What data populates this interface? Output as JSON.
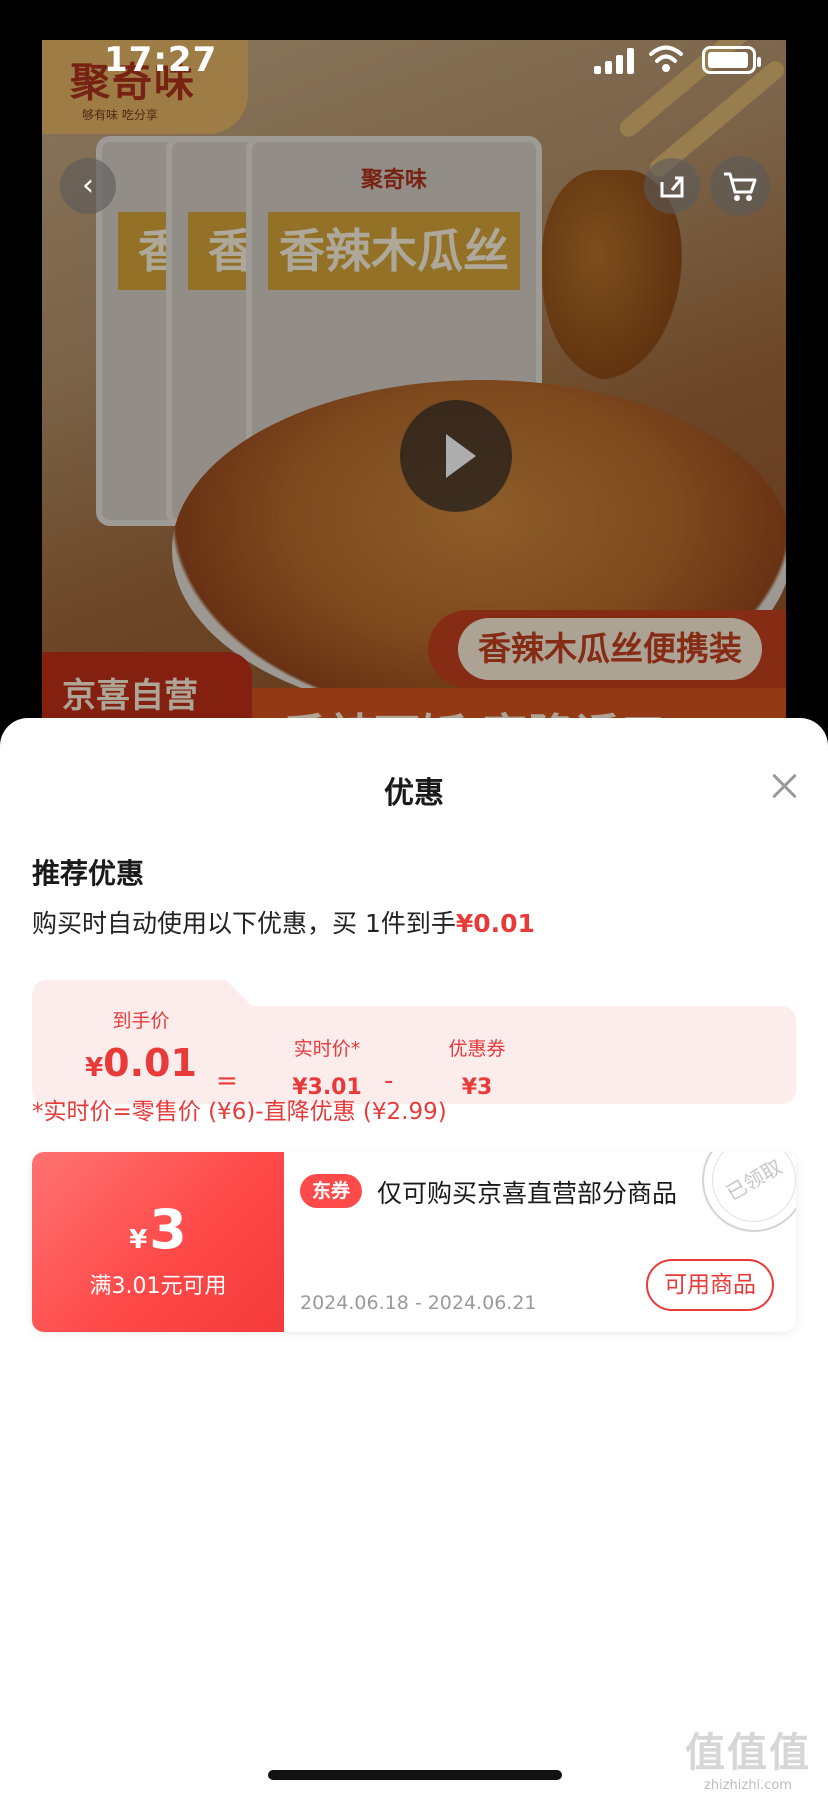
{
  "status_bar": {
    "time": "17:27"
  },
  "product_image": {
    "brand": "聚奇味",
    "brand_slogan": "够有味 吃分享",
    "pack_brand": "聚奇味",
    "pack_label": "香辣木瓜丝",
    "pack_label_short": "香",
    "subtitle": "香辣木瓜丝便携装",
    "bottom_tag": "京喜自营",
    "bottom_headline": "香辣下饭 客隆诱口"
  },
  "sheet": {
    "title": "优惠",
    "section_title": "推荐优惠",
    "desc_prefix": "购买时自动使用以下优惠，买 1件到手",
    "desc_price": "¥0.01",
    "calc": {
      "final_label": "到手价",
      "final_yen": "¥",
      "final_value": "0.01",
      "eq": "=",
      "realtime_label": "实时价*",
      "realtime_value": "¥3.01",
      "minus": "-",
      "coupon_label": "优惠券",
      "coupon_value": "¥3"
    },
    "formula_note": "*实时价=零售价 (¥6)-直降优惠 (¥2.99)",
    "coupon": {
      "yen": "¥",
      "amount": "3",
      "condition": "满3.01元可用",
      "tag": "东券",
      "description": "仅可购买京喜直营部分商品",
      "date_range": "2024.06.18 - 2024.06.21",
      "action_label": "可用商品",
      "stamp": "已领取"
    }
  },
  "watermark": {
    "logo": "值值值",
    "text": "zhizhizhi.com"
  },
  "colors": {
    "accent": "#e93a3a",
    "coupon_gradient_start": "#ff7272",
    "coupon_gradient_end": "#f43a3a",
    "calc_bg": "#fdecec"
  }
}
